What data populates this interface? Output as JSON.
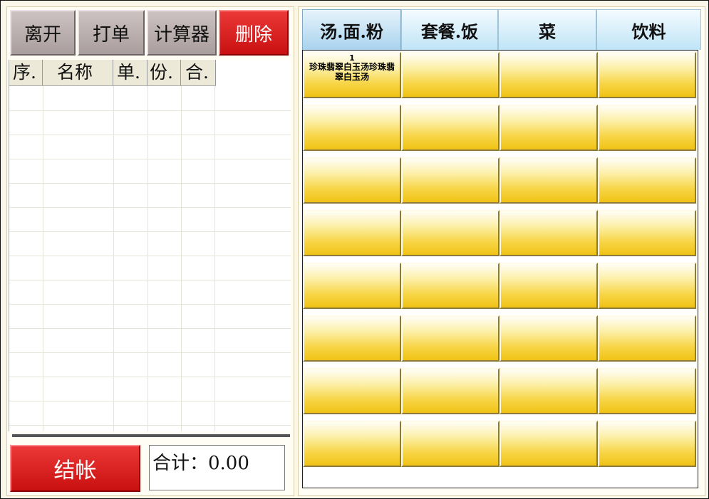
{
  "toolbar": {
    "leave_label": "离开",
    "print_label": "打单",
    "calculator_label": "计算器",
    "delete_label": "删除"
  },
  "order_list": {
    "columns": [
      "序.",
      "名称",
      "单.",
      "份.",
      "合."
    ],
    "rows": []
  },
  "footer": {
    "checkout_label": "结帐",
    "total_text": "合计：0.00"
  },
  "categories": {
    "tabs": [
      "汤.面.粉",
      "套餐.饭",
      "菜",
      "饮料"
    ],
    "active": "汤.面.粉"
  },
  "menu_grid": {
    "items": [
      {
        "number": "1",
        "name": "珍珠翡翠白玉汤珍珠翡翠白玉汤"
      }
    ]
  }
}
